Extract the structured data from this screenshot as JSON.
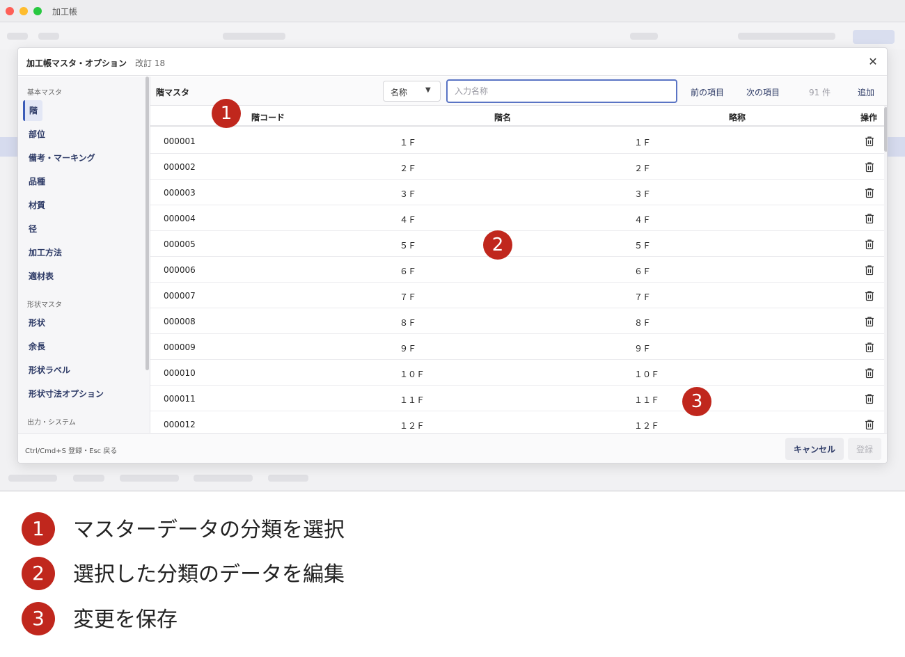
{
  "window": {
    "title": "加工帳"
  },
  "modal": {
    "title": "加工帳マスタ・オプション",
    "revision": "改訂 18",
    "close_icon": "close-icon"
  },
  "sidebar": {
    "groups": [
      {
        "label": "基本マスタ",
        "items": [
          "階",
          "部位",
          "備考・マーキング",
          "品種",
          "材質",
          "径",
          "加工方法",
          "適材表"
        ]
      },
      {
        "label": "形状マスタ",
        "items": [
          "形状",
          "余長",
          "形状ラベル",
          "形状寸法オプション"
        ]
      },
      {
        "label": "出力・システム",
        "items": []
      }
    ],
    "active_item": "階"
  },
  "main": {
    "title": "階マスタ",
    "field_select": {
      "value": "名称"
    },
    "search": {
      "placeholder": "入力名称",
      "value": ""
    },
    "prev_label": "前の項目",
    "next_label": "次の項目",
    "count": "91 件",
    "add_label": "追加"
  },
  "table": {
    "columns": [
      "階コード",
      "階名",
      "略称",
      "操作"
    ],
    "rows": [
      {
        "code": "000001",
        "name": "１Ｆ",
        "abbr": "１Ｆ"
      },
      {
        "code": "000002",
        "name": "２Ｆ",
        "abbr": "２Ｆ"
      },
      {
        "code": "000003",
        "name": "３Ｆ",
        "abbr": "３Ｆ"
      },
      {
        "code": "000004",
        "name": "４Ｆ",
        "abbr": "４Ｆ"
      },
      {
        "code": "000005",
        "name": "５Ｆ",
        "abbr": "５Ｆ"
      },
      {
        "code": "000006",
        "name": "６Ｆ",
        "abbr": "６Ｆ"
      },
      {
        "code": "000007",
        "name": "７Ｆ",
        "abbr": "７Ｆ"
      },
      {
        "code": "000008",
        "name": "８Ｆ",
        "abbr": "８Ｆ"
      },
      {
        "code": "000009",
        "name": "９Ｆ",
        "abbr": "９Ｆ"
      },
      {
        "code": "000010",
        "name": "１０Ｆ",
        "abbr": "１０Ｆ"
      },
      {
        "code": "000011",
        "name": "１１Ｆ",
        "abbr": "１１Ｆ"
      },
      {
        "code": "000012",
        "name": "１２Ｆ",
        "abbr": "１２Ｆ"
      }
    ],
    "row_action_icon": "trash-icon"
  },
  "footer": {
    "hint": "Ctrl/Cmd+S 登録・Esc 戻る",
    "cancel_label": "キャンセル",
    "save_label": "登録"
  },
  "callouts": [
    "1",
    "2",
    "3"
  ],
  "legend": [
    {
      "num": "1",
      "text": "マスターデータの分類を選択"
    },
    {
      "num": "2",
      "text": "選択した分類のデータを編集"
    },
    {
      "num": "3",
      "text": "変更を保存"
    }
  ],
  "colors": {
    "accent": "#3b5bb8",
    "callout": "#c0271d",
    "link_text": "#2d3a66"
  }
}
